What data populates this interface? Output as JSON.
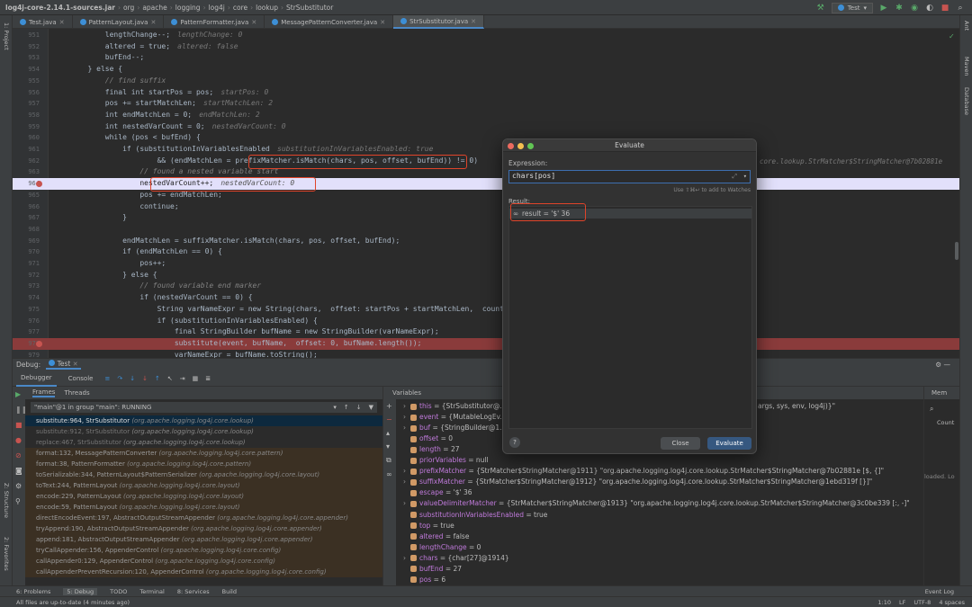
{
  "breadcrumbs": [
    "log4j-core-2.14.1-sources.jar",
    "org",
    "apache",
    "logging",
    "log4j",
    "core",
    "lookup",
    "StrSubstitutor"
  ],
  "run_config": "Test",
  "tabs": [
    "Test.java",
    "PatternLayout.java",
    "PatternFormatter.java",
    "MessagePatternConverter.java",
    "StrSubstitutor.java"
  ],
  "active_tab": 4,
  "left_strip": [
    "1: Project",
    "Z: Structure",
    "2: Favorites"
  ],
  "right_strip": [
    "Ant",
    "Maven",
    "Database"
  ],
  "code_lines": [
    {
      "n": "951",
      "code": "            lengthChange--;",
      "hint": "lengthChange: 0"
    },
    {
      "n": "952",
      "code": "            altered = true;",
      "hint": "altered: false"
    },
    {
      "n": "953",
      "code": "            bufEnd--;",
      "hint": ""
    },
    {
      "n": "954",
      "code": "        } else {",
      "hint": ""
    },
    {
      "n": "955",
      "code": "            // find suffix",
      "hint": ""
    },
    {
      "n": "956",
      "code": "            final int startPos = pos;",
      "hint": "startPos: 0"
    },
    {
      "n": "957",
      "code": "            pos += startMatchLen;",
      "hint": "startMatchLen: 2"
    },
    {
      "n": "958",
      "code": "            int endMatchLen = 0;",
      "hint": "endMatchLen: 2"
    },
    {
      "n": "959",
      "code": "            int nestedVarCount = 0;",
      "hint": "nestedVarCount: 0"
    },
    {
      "n": "960",
      "code": "            while (pos < bufEnd) {",
      "hint": ""
    },
    {
      "n": "961",
      "code": "                if (substitutionInVariablesEnabled",
      "hint": "substitutionInVariablesEnabled: true"
    },
    {
      "n": "962",
      "code": "                        && (endMatchLen = prefixMatcher.isMatch(chars, pos, offset, bufEnd)) != 0)",
      "hint": ""
    },
    {
      "n": "963",
      "code": "                    // found a nested variable start",
      "hint": ""
    },
    {
      "n": "964",
      "code": "                    nestedVarCount++;",
      "hint": "nestedVarCount: 0"
    },
    {
      "n": "965",
      "code": "                    pos += endMatchLen;",
      "hint": ""
    },
    {
      "n": "966",
      "code": "                    continue;",
      "hint": ""
    },
    {
      "n": "967",
      "code": "                }",
      "hint": ""
    },
    {
      "n": "968",
      "code": "",
      "hint": ""
    },
    {
      "n": "969",
      "code": "                endMatchLen = suffixMatcher.isMatch(chars, pos, offset, bufEnd);",
      "hint": ""
    },
    {
      "n": "970",
      "code": "                if (endMatchLen == 0) {",
      "hint": ""
    },
    {
      "n": "971",
      "code": "                    pos++;",
      "hint": ""
    },
    {
      "n": "972",
      "code": "                } else {",
      "hint": ""
    },
    {
      "n": "973",
      "code": "                    // found variable end marker",
      "hint": ""
    },
    {
      "n": "974",
      "code": "                    if (nestedVarCount == 0) {",
      "hint": ""
    },
    {
      "n": "975",
      "code": "                        String varNameExpr = new String(chars,  offset: startPos + startMatchLen,  count",
      "hint": ""
    },
    {
      "n": "976",
      "code": "                        if (substitutionInVariablesEnabled) {",
      "hint": ""
    },
    {
      "n": "977",
      "code": "                            final StringBuilder bufName = new StringBuilder(varNameExpr);",
      "hint": ""
    },
    {
      "n": "978",
      "code": "                            substitute(event, bufName,  offset: 0, bufName.length());",
      "hint": ""
    },
    {
      "n": "979",
      "code": "                            varNameExpr = bufName.toString();",
      "hint": ""
    }
  ],
  "editor_right_hint": "core.lookup.StrMatcher$StringMatcher@7b02881e",
  "debug": {
    "label": "Debug:",
    "session": "Test",
    "tabs": [
      "Debugger",
      "Console"
    ],
    "frames_tabs": [
      "Frames",
      "Threads"
    ],
    "thread": "\"main\"@1 in group \"main\": RUNNING",
    "frames": [
      {
        "m": "substitute:964, StrSubstitutor",
        "p": "(org.apache.logging.log4j.core.lookup)",
        "kind": "sel"
      },
      {
        "m": "substitute:912, StrSubstitutor",
        "p": "(org.apache.logging.log4j.core.lookup)",
        "kind": "plain"
      },
      {
        "m": "replace:467, StrSubstitutor",
        "p": "(org.apache.logging.log4j.core.lookup)",
        "kind": "plain"
      },
      {
        "m": "format:132, MessagePatternConverter",
        "p": "(org.apache.logging.log4j.core.pattern)",
        "kind": "lib"
      },
      {
        "m": "format:38, PatternFormatter",
        "p": "(org.apache.logging.log4j.core.pattern)",
        "kind": "lib"
      },
      {
        "m": "toSerializable:344, PatternLayout$PatternSerializer",
        "p": "(org.apache.logging.log4j.core.layout)",
        "kind": "lib"
      },
      {
        "m": "toText:244, PatternLayout",
        "p": "(org.apache.logging.log4j.core.layout)",
        "kind": "lib"
      },
      {
        "m": "encode:229, PatternLayout",
        "p": "(org.apache.logging.log4j.core.layout)",
        "kind": "lib"
      },
      {
        "m": "encode:59, PatternLayout",
        "p": "(org.apache.logging.log4j.core.layout)",
        "kind": "lib"
      },
      {
        "m": "directEncodeEvent:197, AbstractOutputStreamAppender",
        "p": "(org.apache.logging.log4j.core.appender)",
        "kind": "lib"
      },
      {
        "m": "tryAppend:190, AbstractOutputStreamAppender",
        "p": "(org.apache.logging.log4j.core.appender)",
        "kind": "lib"
      },
      {
        "m": "append:181, AbstractOutputStreamAppender",
        "p": "(org.apache.logging.log4j.core.appender)",
        "kind": "lib"
      },
      {
        "m": "tryCallAppender:156, AppenderControl",
        "p": "(org.apache.logging.log4j.core.config)",
        "kind": "lib"
      },
      {
        "m": "callAppender0:129, AppenderControl",
        "p": "(org.apache.logging.log4j.core.config)",
        "kind": "lib"
      },
      {
        "m": "callAppenderPreventRecursion:120, AppenderControl",
        "p": "(org.apache.logging.log4j.core.config)",
        "kind": "lib"
      }
    ],
    "variables_title": "Variables",
    "variables": [
      {
        "name": "this",
        "value": "= {StrSubstitutor@...",
        "color": "#d19a66",
        "exp": true
      },
      {
        "name": "event",
        "value": "= {MutableLogEv...",
        "color": "#d19a66",
        "exp": true
      },
      {
        "name": "buf",
        "value": "= {StringBuilder@1...",
        "color": "#d19a66",
        "exp": true
      },
      {
        "name": "offset",
        "value": "= 0",
        "color": "#d19a66",
        "exp": false
      },
      {
        "name": "length",
        "value": "= 27",
        "color": "#d19a66",
        "exp": false
      },
      {
        "name": "priorVariables",
        "value": "= null",
        "color": "#d19a66",
        "exp": false
      },
      {
        "name": "prefixMatcher",
        "value": "= {StrMatcher$StringMatcher@1911} \"org.apache.logging.log4j.core.lookup.StrMatcher$StringMatcher@7b02881e [$, {]\"",
        "color": "#d19a66",
        "exp": true
      },
      {
        "name": "suffixMatcher",
        "value": "= {StrMatcher$StringMatcher@1912} \"org.apache.logging.log4j.core.lookup.StrMatcher$StringMatcher@1ebd319f [}]\"",
        "color": "#d19a66",
        "exp": true
      },
      {
        "name": "escape",
        "value": "= '$' 36",
        "color": "#d19a66",
        "exp": false
      },
      {
        "name": "valueDelimiterMatcher",
        "value": "= {StrMatcher$StringMatcher@1913} \"org.apache.logging.log4j.core.lookup.StrMatcher$StringMatcher@3c0be339 [:, -]\"",
        "color": "#d19a66",
        "exp": true
      },
      {
        "name": "substitutionInVariablesEnabled",
        "value": "= true",
        "color": "#d19a66",
        "exp": false
      },
      {
        "name": "top",
        "value": "= true",
        "color": "#d19a66",
        "exp": false
      },
      {
        "name": "altered",
        "value": "= false",
        "color": "#d19a66",
        "exp": false
      },
      {
        "name": "lengthChange",
        "value": "= 0",
        "color": "#d19a66",
        "exp": false
      },
      {
        "name": "chars",
        "value": "= {char[27]@1914}",
        "color": "#d19a66",
        "exp": true
      },
      {
        "name": "bufEnd",
        "value": "= 27",
        "color": "#d19a66",
        "exp": false
      },
      {
        "name": "pos",
        "value": "= 6",
        "color": "#d19a66",
        "exp": false
      }
    ],
    "this_tail": "args, sys, env, log4j)}\"",
    "memory_label": "Mem",
    "count_label": "Count",
    "loaded_label": "loaded. Lo"
  },
  "dialog": {
    "title": "Evaluate",
    "expression_label": "Expression:",
    "expression": "chars[pos]",
    "watch_hint": "Use ⇧⌘↩ to add to Watches",
    "result_label": "Result:",
    "result": "result = '$' 36",
    "close": "Close",
    "evaluate": "Evaluate",
    "help": "?"
  },
  "bottom_tabs": [
    "6: Problems",
    "5: Debug",
    "TODO",
    "Terminal",
    "8: Services",
    "Build"
  ],
  "bottom_right": "Event Log",
  "status_text": "All files are up-to-date (4 minutes ago)",
  "status_right": [
    "1:10",
    "LF",
    "UTF-8",
    "4 spaces"
  ],
  "colors": {
    "accent": "#4a88c7",
    "breakpoint": "#c75450",
    "annotation": "#e0442a",
    "evaluate_button": "#365880"
  }
}
